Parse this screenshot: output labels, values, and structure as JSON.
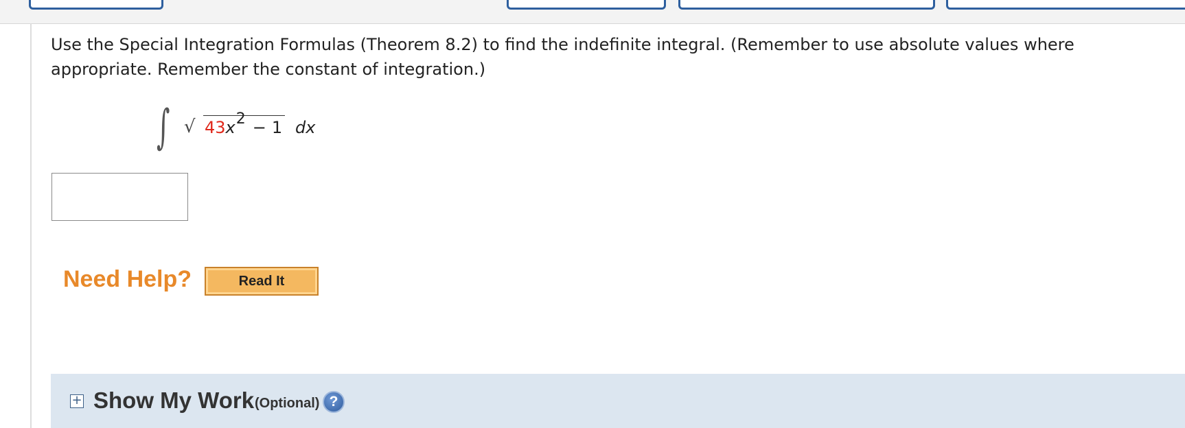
{
  "question": {
    "text": "Use the Special Integration Formulas (Theorem 8.2) to find the indefinite integral. (Remember to use absolute values where appropriate. Remember the constant of integration.)"
  },
  "math": {
    "integral_symbol": "∫",
    "radical_symbol": "√",
    "coefficient": "43",
    "variable": "x",
    "exponent": "2",
    "minus": "−",
    "constant": "1",
    "differential": "dx",
    "coefficient_color": "#e0281b"
  },
  "answer": {
    "value": "",
    "placeholder": ""
  },
  "help": {
    "label": "Need Help?",
    "read_it_label": "Read It",
    "label_color": "#e8892a"
  },
  "show_my_work": {
    "expand_symbol": "+",
    "title": "Show My Work",
    "optional": "(Optional)",
    "help_symbol": "?",
    "icons": {
      "expand": "plus-square-icon",
      "help": "question-circle-icon"
    }
  },
  "colors": {
    "panel_background": "#dce6f0",
    "tab_border": "#2e5f9e",
    "button_background": "#f4b860"
  }
}
